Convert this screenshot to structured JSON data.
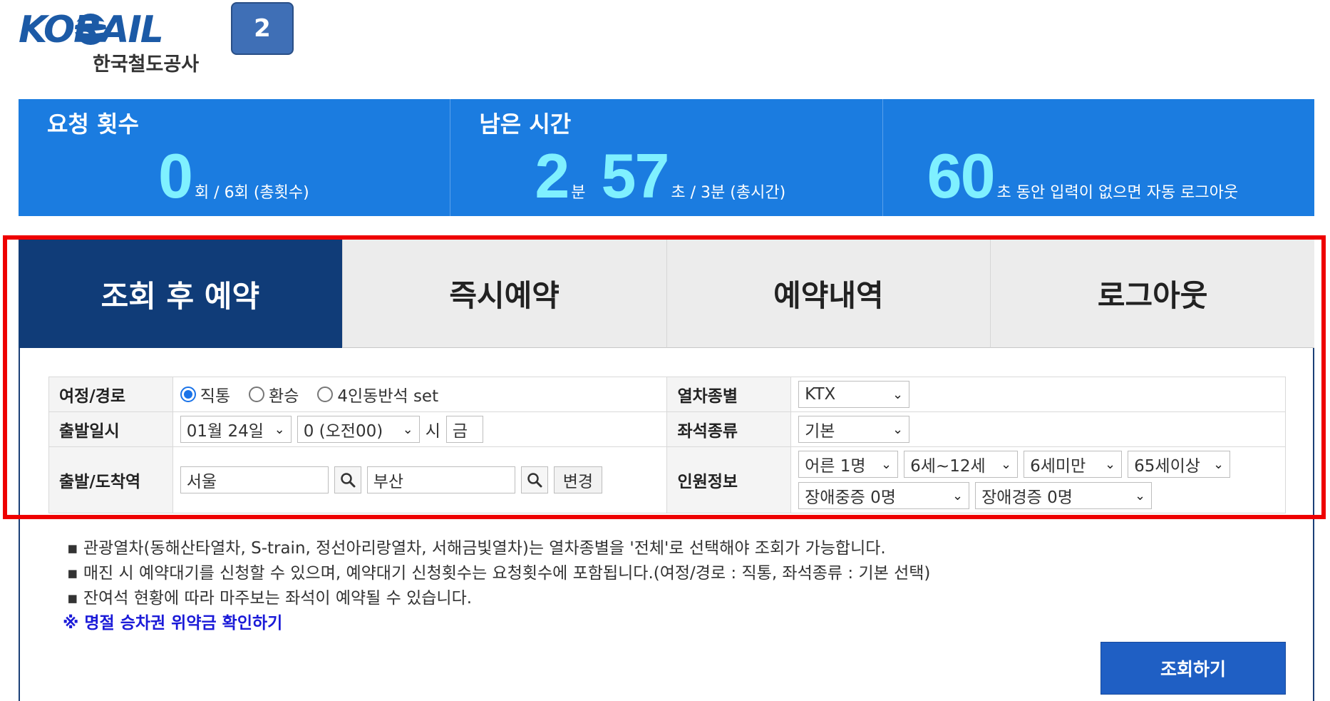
{
  "header": {
    "logo_text": "KORAIL",
    "logo_sub": "한국철도공사",
    "step_badge": "2"
  },
  "stats": {
    "requests": {
      "title": "요청 횟수",
      "value": "0",
      "suffix": "회 / 6회 (총횟수)"
    },
    "remaining": {
      "title": "남은 시간",
      "minutes": "2",
      "min_unit": "분",
      "seconds": "57",
      "suffix": "초 / 3분 (총시간)"
    },
    "idle": {
      "value": "60",
      "suffix": "초 동안 입력이 없으면 자동 로그아웃"
    }
  },
  "tabs": [
    {
      "label": "조회 후 예약",
      "active": true
    },
    {
      "label": "즉시예약",
      "active": false
    },
    {
      "label": "예약내역",
      "active": false
    },
    {
      "label": "로그아웃",
      "active": false
    }
  ],
  "form": {
    "route": {
      "label": "여정/경로",
      "options": [
        "직통",
        "환승",
        "4인동반석 set"
      ],
      "selected": "직통"
    },
    "train_type": {
      "label": "열차종별",
      "value": "KTX"
    },
    "departure": {
      "label": "출발일시",
      "date": "01월 24일",
      "hour": "0 (오전00)",
      "hour_unit": "시",
      "weekday": "금"
    },
    "seat_type": {
      "label": "좌석종류",
      "value": "기본"
    },
    "stations": {
      "label": "출발/도착역",
      "from": "서울",
      "to": "부산",
      "swap_label": "변경"
    },
    "passengers": {
      "label": "인원정보",
      "adult": "어른 1명",
      "child": "6세~12세",
      "infant": "6세미만",
      "senior": "65세이상",
      "disabled_severe": "장애중증 0명",
      "disabled_mild": "장애경증 0명"
    }
  },
  "notes": [
    "▪ 관광열차(동해산타열차, S-train, 정선아리랑열차, 서해금빛열차)는 열차종별을 '전체'로 선택해야 조회가 가능합니다.",
    "▪ 매진 시 예약대기를 신청할 수 있으며, 예약대기 신청횟수는 요청횟수에 포함됩니다.(여정/경로 : 직통, 좌석종류 : 기본 선택)",
    "▪ 잔여석 현황에 따라 마주보는 좌석이 예약될 수 있습니다."
  ],
  "penalty_link": "※ 명절 승차권 위약금 확인하기",
  "search_button": "조회하기",
  "colors": {
    "banner": "#1b7ce0",
    "banner_number": "#7ff0ff",
    "active_tab": "#103c78",
    "highlight": "#ee0000",
    "search_button": "#1f5fc4"
  }
}
